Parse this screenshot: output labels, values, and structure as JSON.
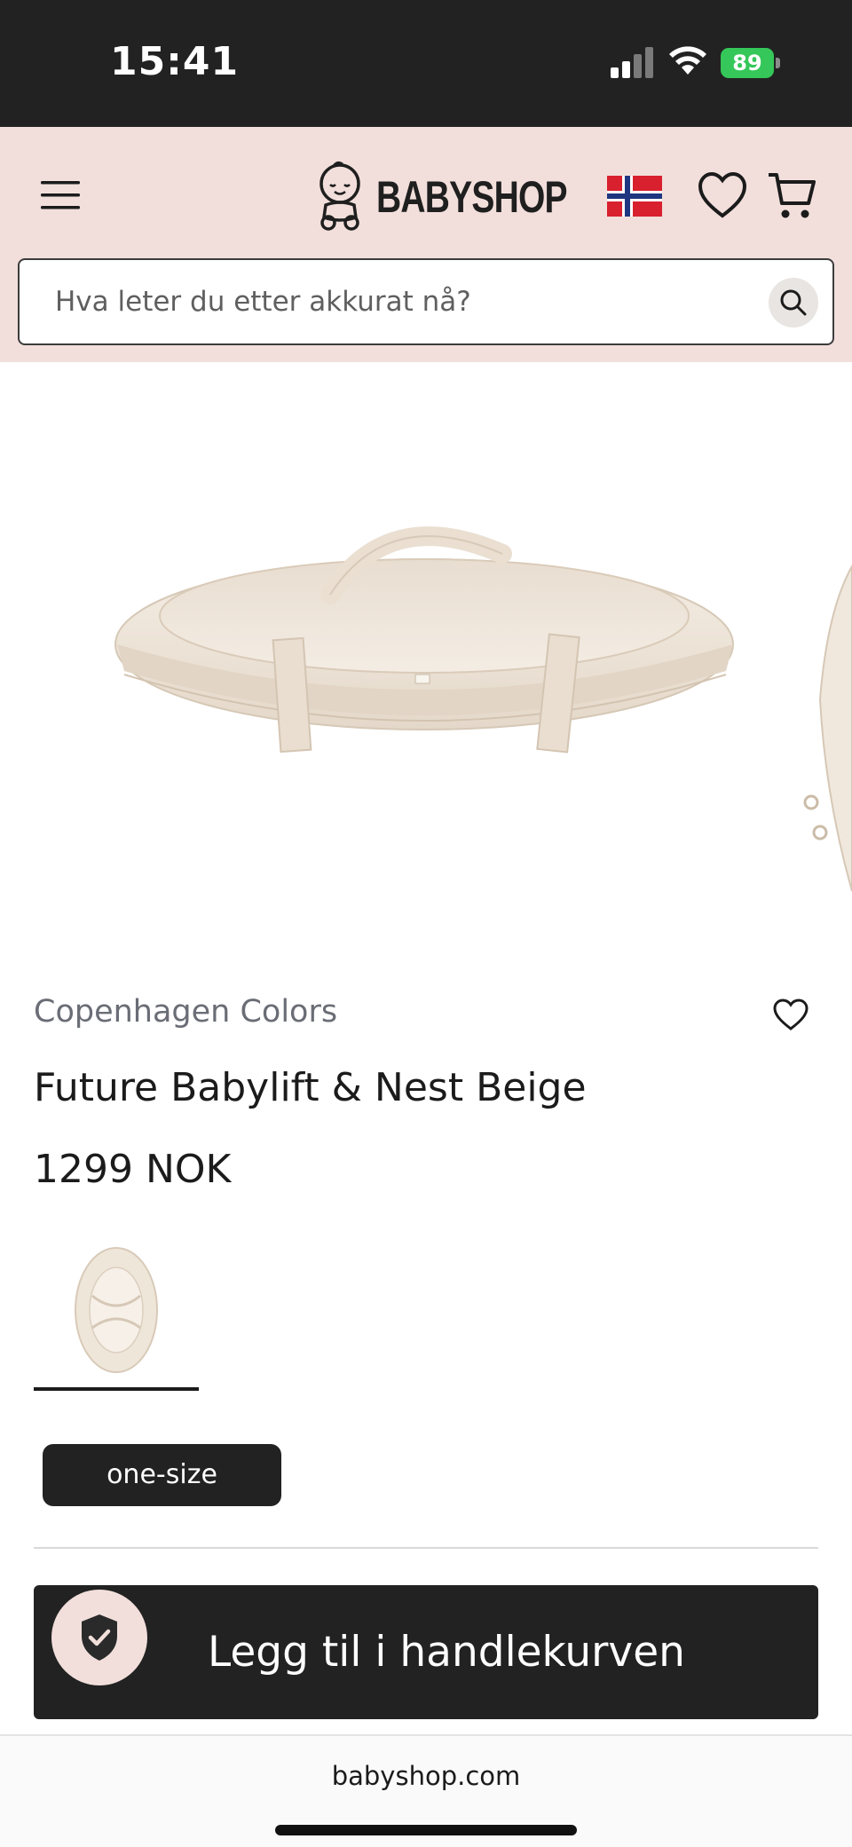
{
  "status_bar": {
    "time": "15:41",
    "battery": "89"
  },
  "header": {
    "logo_text": "BABYSHOP",
    "search": {
      "placeholder": "Hva leter du etter akkurat nå?"
    },
    "country_flag": "norway-flag"
  },
  "product": {
    "brand": "Copenhagen Colors",
    "name": "Future Babylift & Nest Beige",
    "price": "1299 NOK",
    "size_label": "one-size",
    "add_to_cart_label": "Legg til i handlekurven"
  },
  "browser": {
    "url": "babyshop.com"
  },
  "colors": {
    "header_bg": "#f2dfdb",
    "dark": "#222222",
    "battery_green": "#35c759"
  }
}
